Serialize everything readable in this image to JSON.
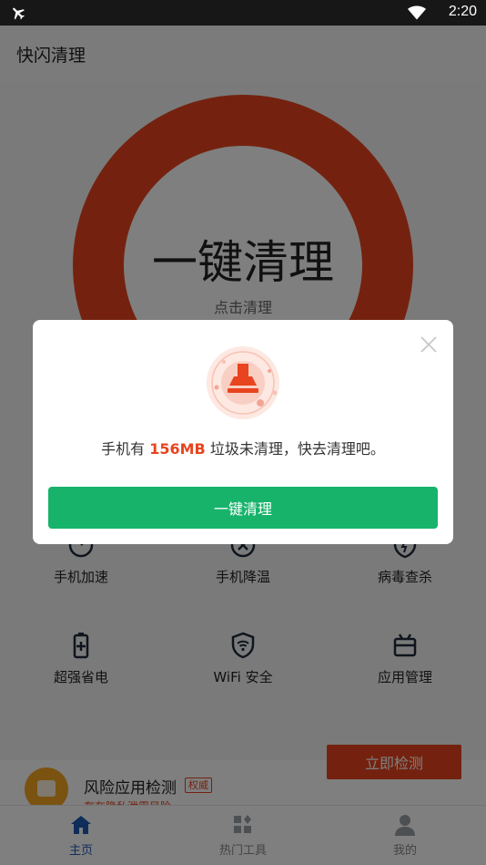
{
  "status_bar": {
    "time": "2:20",
    "icons": [
      "airplane-mode-icon",
      "wifi-icon"
    ]
  },
  "app_bar": {
    "title": "快闪清理"
  },
  "clean_ring": {
    "title": "一键清理",
    "subtitle": "点击清理",
    "color": "#e8441f"
  },
  "tools": [
    {
      "label": "手机加速",
      "icon": "speed-icon"
    },
    {
      "label": "手机降温",
      "icon": "fan-icon"
    },
    {
      "label": "病毒查杀",
      "icon": "shield-icon"
    },
    {
      "label": "超强省电",
      "icon": "battery-icon"
    },
    {
      "label": "WiFi 安全",
      "icon": "wifi-shield-icon"
    },
    {
      "label": "应用管理",
      "icon": "app-manage-icon"
    }
  ],
  "risk_banner": {
    "title": "风险应用检测",
    "tag": "权威",
    "subtitle": "存在隐私泄露风险",
    "button": "立即检测"
  },
  "tab_bar": [
    {
      "label": "主页",
      "icon": "home-icon",
      "active": true
    },
    {
      "label": "热门工具",
      "icon": "tools-icon",
      "active": false
    },
    {
      "label": "我的",
      "icon": "user-icon",
      "active": false
    }
  ],
  "dialog": {
    "message_prefix": "手机有 ",
    "junk_size": "156MB",
    "message_suffix": " 垃圾未清理，快去清理吧。",
    "button": "一键清理",
    "accent_color": "#17b36b",
    "highlight_color": "#e8441f"
  }
}
